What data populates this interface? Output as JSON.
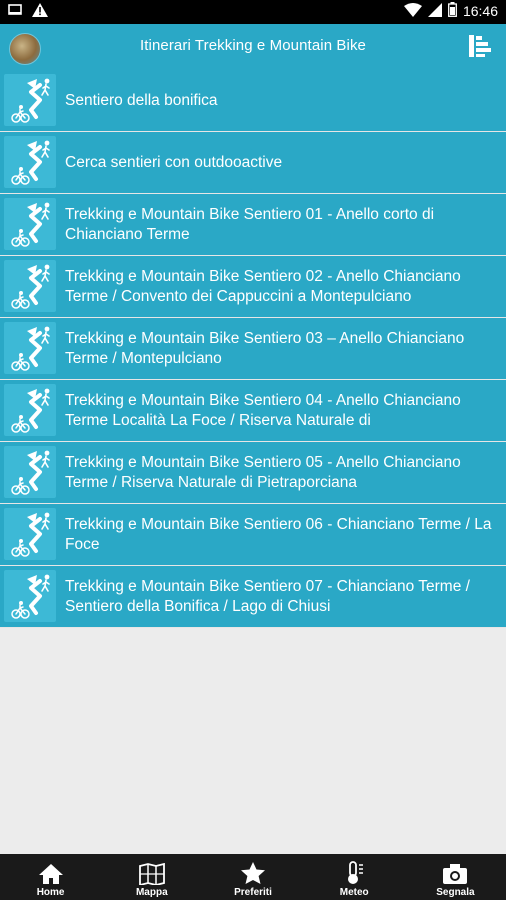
{
  "status_bar": {
    "time": "16:46",
    "icons": [
      "screen-icon",
      "warning-icon",
      "wifi-icon",
      "signal-icon",
      "battery-icon"
    ]
  },
  "header": {
    "title": "Itinerari Trekking e Mountain Bike",
    "logo_icon": "app-logo-icon",
    "menu_icon": "list-menu-icon"
  },
  "list": {
    "items": [
      {
        "label": "Sentiero della bonifica"
      },
      {
        "label": "Cerca sentieri con outdooactive"
      },
      {
        "label": "Trekking e Mountain Bike Sentiero 01 - Anello corto di Chianciano Terme"
      },
      {
        "label": "Trekking e Mountain Bike Sentiero 02 - Anello Chianciano Terme / Convento dei Cappuccini a Montepulciano"
      },
      {
        "label": "Trekking e Mountain Bike Sentiero 03 – Anello Chianciano Terme / Montepulciano"
      },
      {
        "label": "Trekking e Mountain Bike Sentiero 04 - Anello Chianciano Terme Località La Foce / Riserva Naturale di"
      },
      {
        "label": "Trekking e Mountain Bike Sentiero 05 - Anello Chianciano Terme / Riserva Naturale di Pietraporciana"
      },
      {
        "label": "Trekking e Mountain Bike Sentiero  06 - Chianciano Terme / La Foce"
      },
      {
        "label": "Trekking e Mountain Bike Sentiero 07 - Chianciano Terme / Sentiero della Bonifica / Lago di Chiusi"
      }
    ]
  },
  "bottom_nav": {
    "items": [
      {
        "label": "Home",
        "icon": "home-icon"
      },
      {
        "label": "Mappa",
        "icon": "map-icon"
      },
      {
        "label": "Preferiti",
        "icon": "star-icon"
      },
      {
        "label": "Meteo",
        "icon": "weather-icon"
      },
      {
        "label": "Segnala",
        "icon": "camera-icon"
      }
    ]
  },
  "colors": {
    "accent": "#2aa8c6",
    "icon_tile": "#3db9d6",
    "background": "#ececec",
    "nav_background": "#1a1a1a"
  }
}
